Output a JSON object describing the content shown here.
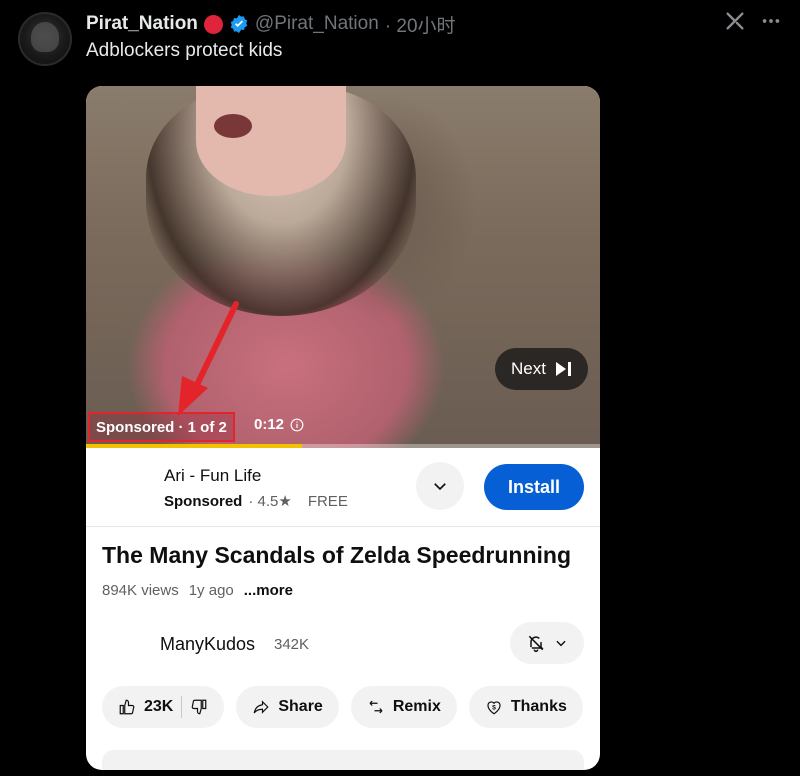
{
  "post": {
    "author": "Pirat_Nation",
    "handle": "@Pirat_Nation",
    "time": "· 20小时",
    "text": "Adblockers protect kids",
    "icons": [
      "red-circle-icon",
      "verified-badge-icon",
      "grok-icon",
      "more-icon"
    ]
  },
  "video": {
    "next_label": "Next",
    "sponsored": "Sponsored · 1 of 2",
    "time": "0:12",
    "progress": 0.42,
    "highlight_color": "#e3242b"
  },
  "ad": {
    "app_name": "Ari - Fun Life",
    "sponsored": "Sponsored",
    "rating": "· 4.5★",
    "price": "FREE",
    "install_label": "Install"
  },
  "main": {
    "title": "The Many Scandals of Zelda Speedrunning",
    "views": "894K views",
    "age": "1y ago",
    "more": "...more",
    "channel": "ManyKudos",
    "subscribers": "342K"
  },
  "actions": {
    "likes": "23K",
    "share": "Share",
    "remix": "Remix",
    "thanks": "Thanks"
  },
  "colors": {
    "accent": "#065fd4",
    "verified": "#1d9bf0",
    "badge_red": "#e0243b",
    "progress": "#f2c200"
  }
}
